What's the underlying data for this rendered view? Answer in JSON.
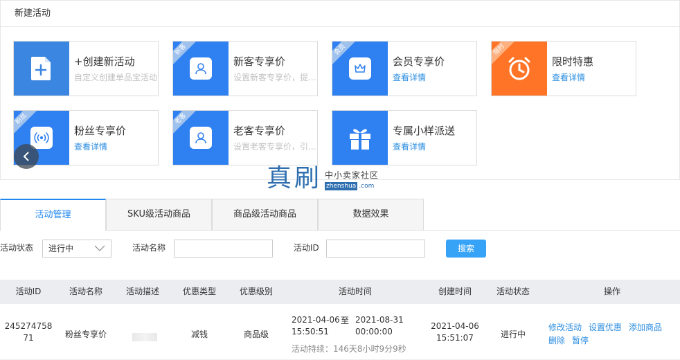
{
  "panel": {
    "title": "新建活动"
  },
  "cards": [
    {
      "title": "+创建新活动",
      "sub": "自定义创建单品宝活动",
      "link": "",
      "corner": "",
      "color": "#3b86e0",
      "icon": "file-plus-icon"
    },
    {
      "title": "新客专享价",
      "sub": "设置新客专享价，提...",
      "link": "",
      "corner": "新客",
      "color": "#2f80f0",
      "icon": "user-icon"
    },
    {
      "title": "会员专享价",
      "sub": "",
      "link": "查看详情",
      "corner": "会员",
      "color": "#2f80f0",
      "icon": "crown-icon"
    },
    {
      "title": "限时特惠",
      "sub": "",
      "link": "查看详情",
      "corner": "限时",
      "color": "#ff7426",
      "icon": "alarm-clock-icon"
    },
    {
      "title": "粉丝专享价",
      "sub": "",
      "link": "查看详情",
      "corner": "粉丝",
      "color": "#2f80f0",
      "icon": "broadcast-icon"
    },
    {
      "title": "老客专享价",
      "sub": "设置老客专享价，引...",
      "link": "",
      "corner": "老客",
      "color": "#2f80f0",
      "icon": "user-icon"
    },
    {
      "title": "专属小样派送",
      "sub": "",
      "link": "查看详情",
      "corner": "",
      "color": "#2f80f0",
      "icon": "gift-icon"
    }
  ],
  "watermark": {
    "big": "真刷",
    "top": "中小卖家社区",
    "url": "zhenshua",
    "com": ".com"
  },
  "tabs": [
    "活动管理",
    "SKU级活动商品",
    "商品级活动商品",
    "数据效果"
  ],
  "filters": {
    "status_label": "活动状态",
    "status_value": "进行中",
    "name_label": "活动名称",
    "name_value": "",
    "id_label": "活动ID",
    "id_value": "",
    "search_button": "搜索"
  },
  "table": {
    "columns": [
      "活动ID",
      "活动名称",
      "活动描述",
      "优惠类型",
      "优惠级别",
      "活动时间",
      "创建时间",
      "活动状态",
      "操作"
    ],
    "rows": [
      {
        "id_line1": "245274758",
        "id_line2": "71",
        "name": "粉丝专享价",
        "discount_type": "减钱",
        "discount_level": "商品级",
        "start_date": "2021-04-06",
        "start_time": "15:50:51",
        "to": "至",
        "end_date": "2021-08-31",
        "end_time": "00:00:00",
        "duration": "活动持续：146天8小时9分9秒",
        "created_date": "2021-04-06",
        "created_time": "15:51:07",
        "status": "进行中",
        "ops": [
          "修改活动",
          "设置优惠",
          "添加商品",
          "删除",
          "暂停"
        ]
      }
    ]
  }
}
